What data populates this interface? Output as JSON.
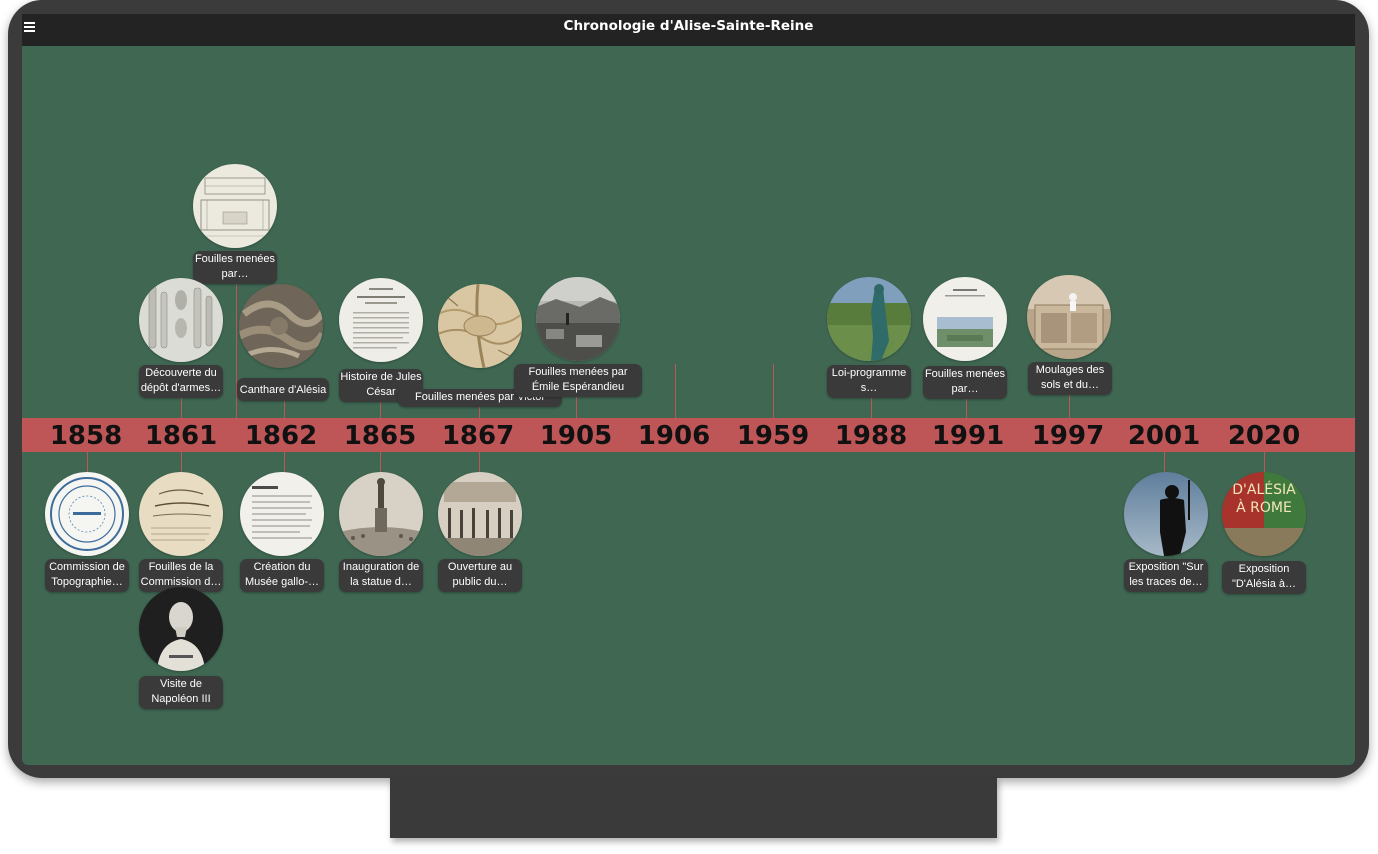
{
  "app": {
    "title": "Chronologie d'Alise-Sainte-Reine"
  },
  "years": [
    "1858",
    "1861",
    "1862",
    "1865",
    "1867",
    "1905",
    "1906",
    "1959",
    "1988",
    "1991",
    "1997",
    "2001",
    "2020"
  ],
  "events": {
    "commission_topographie": "Commission de Topographie…",
    "decouverte_depot": "Découverte du dépôt d'armes…",
    "fouilles_commission": "Fouilles de la Commission d…",
    "visite_napoleon": "Visite de Napoléon III",
    "fouilles_menees_par_1": "Fouilles menées par…",
    "canthare": "Canthare d'Alésia",
    "creation_musee": "Création du Musée gallo-…",
    "histoire_jules_cesar": "Histoire de Jules César",
    "inauguration_statue": "Inauguration de la statue d…",
    "fouilles_pernet": "Fouilles menées par Victor Pernet",
    "ouverture_public": "Ouverture au public du…",
    "fouilles_esperandieu": "Fouilles menées par Émile Espérandieu",
    "loi_programme": "Loi-programme s…",
    "fouilles_menees_par_2": "Fouilles menées par…",
    "moulages": "Moulages des sols et du…",
    "exposition_sur_traces": "Exposition \"Sur les traces de…",
    "exposition_alesia_rome": "Exposition \"D'Alésia à…"
  },
  "poster_2020": {
    "line1": "D'ALÉSIA",
    "line2": "À ROME"
  },
  "colors": {
    "screen": "#3f6752",
    "band": "#be5658",
    "topbar": "#232323",
    "label_bg": "#3a3a3a"
  }
}
